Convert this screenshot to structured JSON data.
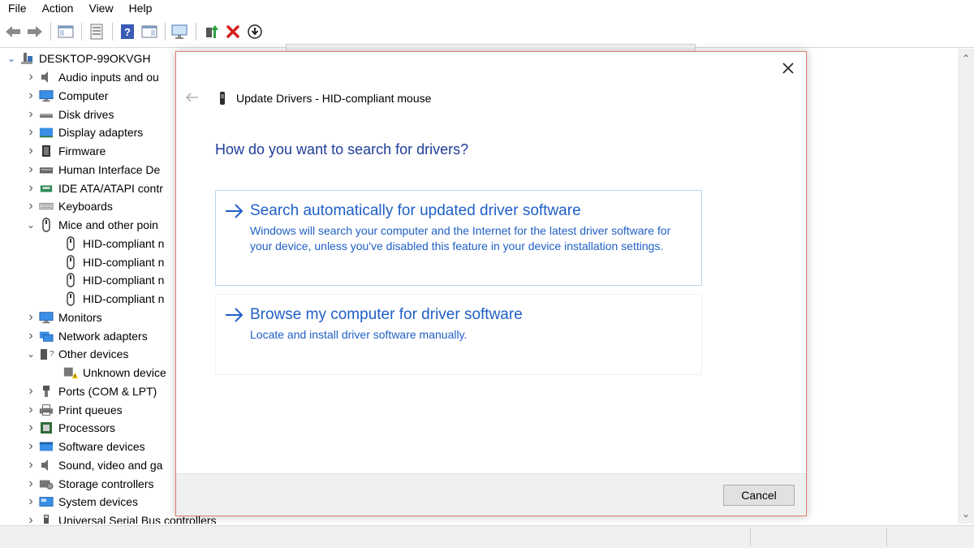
{
  "menu": [
    "File",
    "Action",
    "View",
    "Help"
  ],
  "tree": {
    "root": "DESKTOP-99OKVGH",
    "items": [
      {
        "label": "Audio inputs and ou",
        "icon": "speaker-icon",
        "expanded": false
      },
      {
        "label": "Computer",
        "icon": "monitor-icon",
        "expanded": false
      },
      {
        "label": "Disk drives",
        "icon": "disk-drive-icon",
        "expanded": false
      },
      {
        "label": "Display adapters",
        "icon": "display-adapter-icon",
        "expanded": false
      },
      {
        "label": "Firmware",
        "icon": "chip-icon",
        "expanded": false
      },
      {
        "label": "Human Interface De",
        "icon": "hid-icon",
        "expanded": false
      },
      {
        "label": "IDE ATA/ATAPI contr",
        "icon": "ide-controller-icon",
        "expanded": false
      },
      {
        "label": "Keyboards",
        "icon": "keyboard-icon",
        "expanded": false
      },
      {
        "label": "Mice and other poin",
        "icon": "mouse-icon",
        "expanded": true
      },
      {
        "label": "HID-compliant n",
        "icon": "mouse-icon",
        "child": true
      },
      {
        "label": "HID-compliant n",
        "icon": "mouse-icon",
        "child": true
      },
      {
        "label": "HID-compliant n",
        "icon": "mouse-icon",
        "child": true
      },
      {
        "label": "HID-compliant n",
        "icon": "mouse-icon",
        "child": true
      },
      {
        "label": "Monitors",
        "icon": "monitor-icon",
        "expanded": false
      },
      {
        "label": "Network adapters",
        "icon": "network-icon",
        "expanded": false
      },
      {
        "label": "Other devices",
        "icon": "unknown-device-icon",
        "expanded": true
      },
      {
        "label": "Unknown device",
        "icon": "warning-device-icon",
        "child": true
      },
      {
        "label": "Ports (COM & LPT)",
        "icon": "port-icon",
        "expanded": false
      },
      {
        "label": "Print queues",
        "icon": "printer-icon",
        "expanded": false
      },
      {
        "label": "Processors",
        "icon": "processor-icon",
        "expanded": false
      },
      {
        "label": "Software devices",
        "icon": "software-device-icon",
        "expanded": false
      },
      {
        "label": "Sound, video and ga",
        "icon": "speaker-icon",
        "expanded": false
      },
      {
        "label": "Storage controllers",
        "icon": "storage-icon",
        "expanded": false
      },
      {
        "label": "System devices",
        "icon": "system-icon",
        "expanded": false
      },
      {
        "label": "Universal Serial Bus controllers",
        "icon": "usb-icon",
        "expanded": false
      }
    ]
  },
  "dialog": {
    "title": "Update Drivers - HID-compliant mouse",
    "heading": "How do you want to search for drivers?",
    "option1": {
      "title": "Search automatically for updated driver software",
      "desc": "Windows will search your computer and the Internet for the latest driver software for your device, unless you've disabled this feature in your device installation settings."
    },
    "option2": {
      "title": "Browse my computer for driver software",
      "desc": "Locate and install driver software manually."
    },
    "cancel_label": "Cancel",
    "close_icon": "close-icon",
    "back_icon": "back-arrow-icon"
  },
  "colors": {
    "link_blue": "#1f5fc6",
    "heading_blue": "#1e3d9a",
    "dialog_border": "#e07d6b",
    "option_border": "#bcd6ee"
  }
}
